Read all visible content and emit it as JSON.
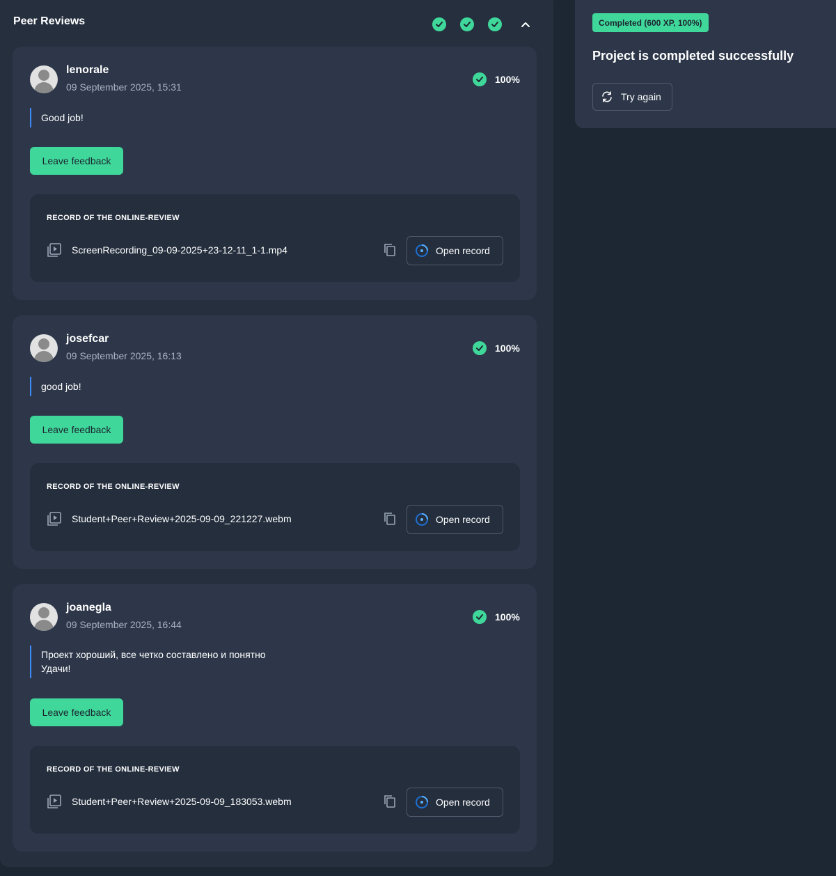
{
  "peer_reviews": {
    "title": "Peer Reviews",
    "header_checks": [
      "check-icon",
      "check-icon",
      "check-icon"
    ],
    "collapse_icon": "chevron-up-icon",
    "record_label": "RECORD OF THE ONLINE-REVIEW",
    "feedback_label": "Leave feedback",
    "open_record_label": "Open record",
    "reviews": [
      {
        "name": "lenorale",
        "date": "09 September 2025, 15:31",
        "score": "100%",
        "comment_lines": [
          "Good job!"
        ],
        "file": "ScreenRecording_09-09-2025+23-12-11_1-1.mp4"
      },
      {
        "name": "josefcar",
        "date": "09 September 2025, 16:13",
        "score": "100%",
        "comment_lines": [
          "good job!"
        ],
        "file": "Student+Peer+Review+2025-09-09_221227.webm"
      },
      {
        "name": "joanegla",
        "date": "09 September 2025, 16:44",
        "score": "100%",
        "comment_lines": [
          "Проект хороший, все четко составлено и понятно",
          "Удачи!"
        ],
        "file": "Student+Peer+Review+2025-09-09_183053.webm"
      }
    ]
  },
  "status": {
    "badge": "Completed (600 XP, 100%)",
    "title": "Project is completed successfully",
    "try_again_label": "Try again"
  },
  "colors": {
    "accent_green": "#3fd89a",
    "comment_bar_blue": "#3d8bfd",
    "background": "#1d2633",
    "card": "#2d3749"
  }
}
